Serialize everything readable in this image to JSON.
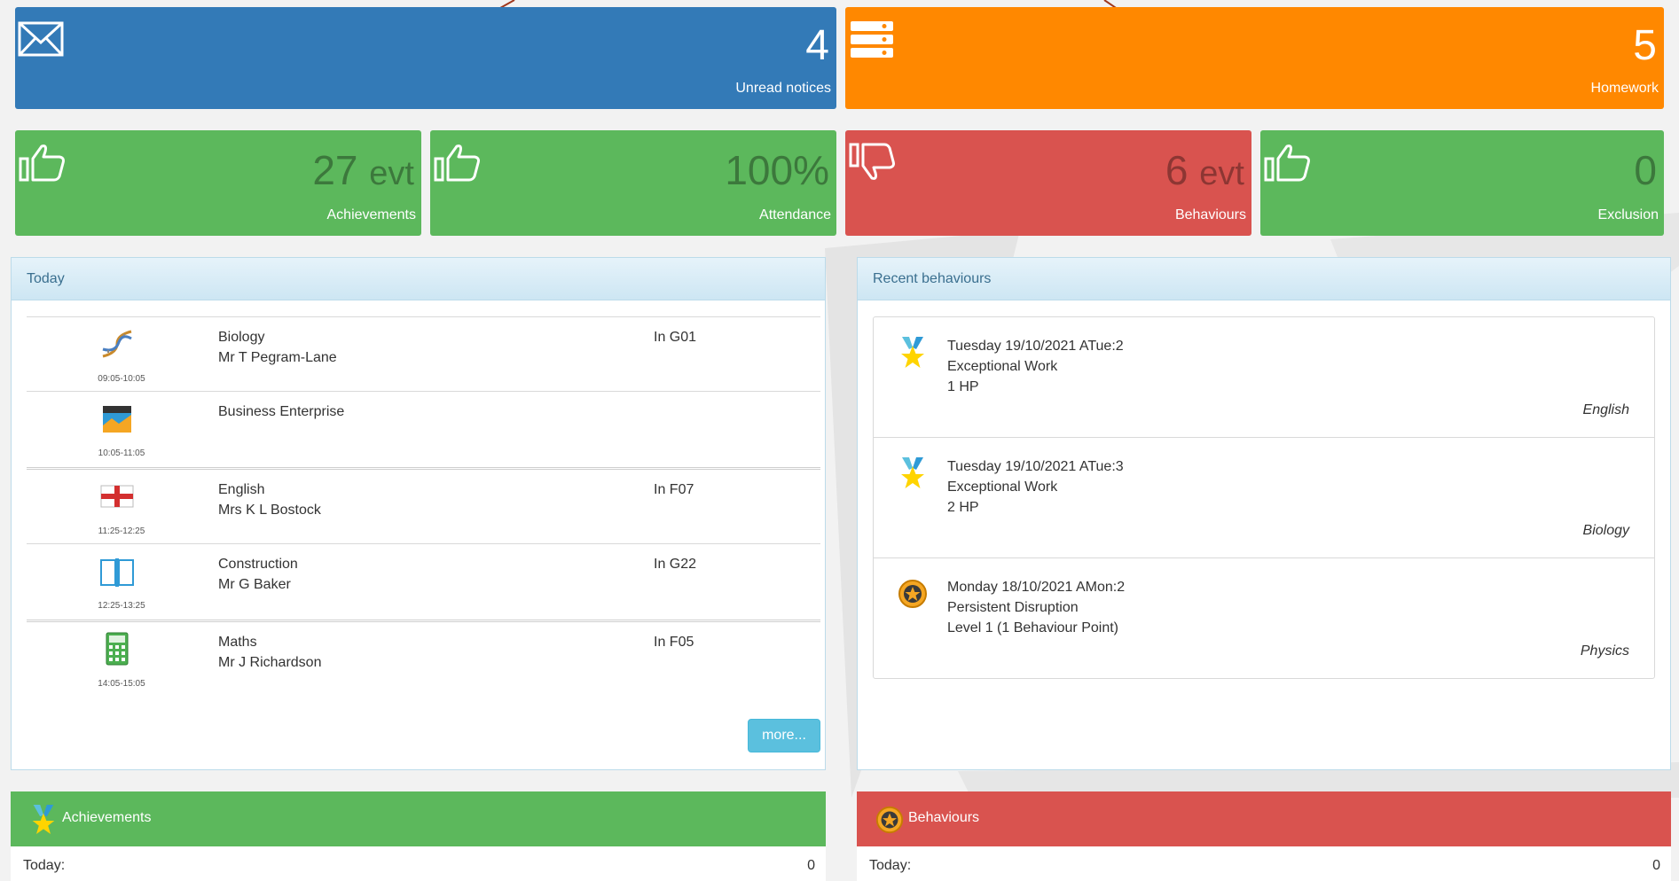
{
  "tiles": {
    "notices": {
      "value": "4",
      "label": "Unread notices",
      "color": "#337ab7",
      "icon": "envelope-icon"
    },
    "homework": {
      "value": "5",
      "label": "Homework",
      "color": "#ff8800",
      "icon": "list-icon"
    },
    "achievements": {
      "value": "27",
      "unit": "evt",
      "label": "Achievements",
      "color": "#5cb85c",
      "icon": "thumbs-up-icon"
    },
    "attendance": {
      "value": "100%",
      "label": "Attendance",
      "color": "#5cb85c",
      "icon": "thumbs-up-icon"
    },
    "behaviours": {
      "value": "6",
      "unit": "evt",
      "label": "Behaviours",
      "color": "#d9534f",
      "icon": "thumbs-down-icon"
    },
    "exclusion": {
      "value": "0",
      "label": "Exclusion",
      "color": "#5cb85c",
      "icon": "thumbs-up-icon"
    }
  },
  "today": {
    "title": "Today",
    "lessons": [
      {
        "subject": "Biology",
        "teacher": "Mr T Pegram-Lane",
        "room": "In G01",
        "time": "09:05-10:05",
        "icon": "dna-icon"
      },
      {
        "subject": "Business Enterprise",
        "teacher": "",
        "room": "",
        "time": "10:05-11:05",
        "icon": "business-icon"
      },
      {
        "subject": "English",
        "teacher": "Mrs K L Bostock",
        "room": "In F07",
        "time": "11:25-12:25",
        "icon": "england-flag-icon"
      },
      {
        "subject": "Construction",
        "teacher": "Mr G Baker",
        "room": "In G22",
        "time": "12:25-13:25",
        "icon": "book-icon"
      },
      {
        "subject": "Maths",
        "teacher": "Mr J Richardson",
        "room": "In F05",
        "time": "14:05-15:05",
        "icon": "calculator-icon"
      }
    ],
    "more_label": "more..."
  },
  "recent_behaviours": {
    "title": "Recent behaviours",
    "items": [
      {
        "date": "Tuesday 19/10/2021 ATue:2",
        "type": "Exceptional Work",
        "points": "1 HP",
        "subject": "English",
        "icon": "medal-icon"
      },
      {
        "date": "Tuesday 19/10/2021 ATue:3",
        "type": "Exceptional Work",
        "points": "2 HP",
        "subject": "Biology",
        "icon": "medal-icon"
      },
      {
        "date": "Monday 18/10/2021 AMon:2",
        "type": "Persistent Disruption",
        "points": "Level 1 (1 Behaviour Point)",
        "subject": "Physics",
        "icon": "badge-icon"
      }
    ]
  },
  "achievements_panel": {
    "title": "Achievements",
    "row_label": "Today:",
    "row_value": "0",
    "color": "#5cb85c"
  },
  "behaviours_panel": {
    "title": "Behaviours",
    "row_label": "Today:",
    "row_value": "0",
    "color": "#d9534f"
  }
}
